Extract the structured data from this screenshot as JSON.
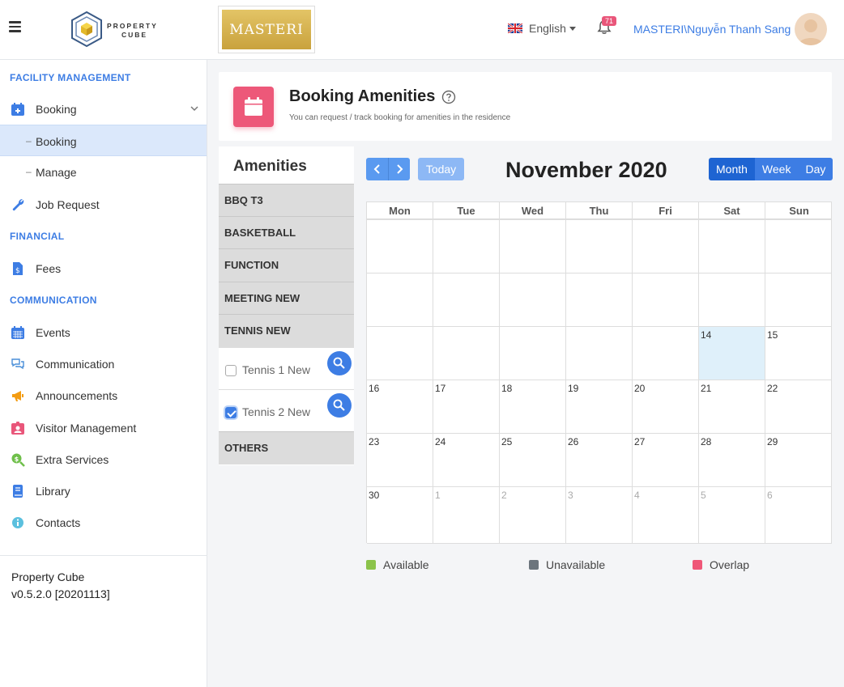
{
  "header": {
    "logo_line1": "PROPERTY",
    "logo_line2": "CUBE",
    "client_logo_text": "MASTERI",
    "language": "English",
    "notification_count": "71",
    "username": "MASTERI\\Nguyễn Thanh Sang"
  },
  "sidebar": {
    "sections": {
      "facility": "FACILITY MANAGEMENT",
      "financial": "FINANCIAL",
      "communication": "COMMUNICATION"
    },
    "items": [
      {
        "label": "Booking",
        "icon": "calendar-plus-icon"
      },
      {
        "label": "Booking",
        "icon": "dash"
      },
      {
        "label": "Manage",
        "icon": "dash"
      },
      {
        "label": "Job Request",
        "icon": "wrench-icon"
      },
      {
        "label": "Fees",
        "icon": "invoice-icon"
      },
      {
        "label": "Events",
        "icon": "calendar-icon"
      },
      {
        "label": "Communication",
        "icon": "chat-icon"
      },
      {
        "label": "Announcements",
        "icon": "megaphone-icon"
      },
      {
        "label": "Visitor Management",
        "icon": "id-badge-icon"
      },
      {
        "label": "Extra Services",
        "icon": "dollar-search-icon"
      },
      {
        "label": "Library",
        "icon": "book-icon"
      },
      {
        "label": "Contacts",
        "icon": "info-icon"
      }
    ],
    "footer": {
      "name": "Property Cube",
      "version": "v0.5.2.0 [20201113]"
    }
  },
  "page": {
    "title": "Booking Amenities",
    "subtitle": "You can request / track booking for amenities in the residence",
    "accent": "#ed5879"
  },
  "amenities": {
    "title": "Amenities",
    "groups": [
      "BBQ T3",
      "BASKETBALL",
      "FUNCTION",
      "MEETING NEW",
      "TENNIS NEW",
      "OTHERS"
    ],
    "tennis_items": [
      {
        "label": "Tennis 1 New",
        "checked": false
      },
      {
        "label": "Tennis 2 New",
        "checked": true
      }
    ]
  },
  "calendar": {
    "title": "November 2020",
    "today_label": "Today",
    "views": [
      "Month",
      "Week",
      "Day"
    ],
    "active_view": "Month",
    "weekdays": [
      "Mon",
      "Tue",
      "Wed",
      "Thu",
      "Fri",
      "Sat",
      "Sun"
    ],
    "weeks": [
      [
        "",
        "",
        "",
        "",
        "",
        "",
        ""
      ],
      [
        "",
        "",
        "",
        "",
        "",
        "",
        ""
      ],
      [
        "",
        "",
        "",
        "",
        "",
        "14",
        "15"
      ],
      [
        "16",
        "17",
        "18",
        "19",
        "20",
        "21",
        "22"
      ],
      [
        "23",
        "24",
        "25",
        "26",
        "27",
        "28",
        "29"
      ],
      [
        "30",
        "1",
        "2",
        "3",
        "4",
        "5",
        "6"
      ]
    ],
    "today": "14",
    "legend": [
      {
        "label": "Available",
        "color": "#8bc34a"
      },
      {
        "label": "Unavailable",
        "color": "#6c757d"
      },
      {
        "label": "Overlap",
        "color": "#ef5778"
      }
    ]
  }
}
